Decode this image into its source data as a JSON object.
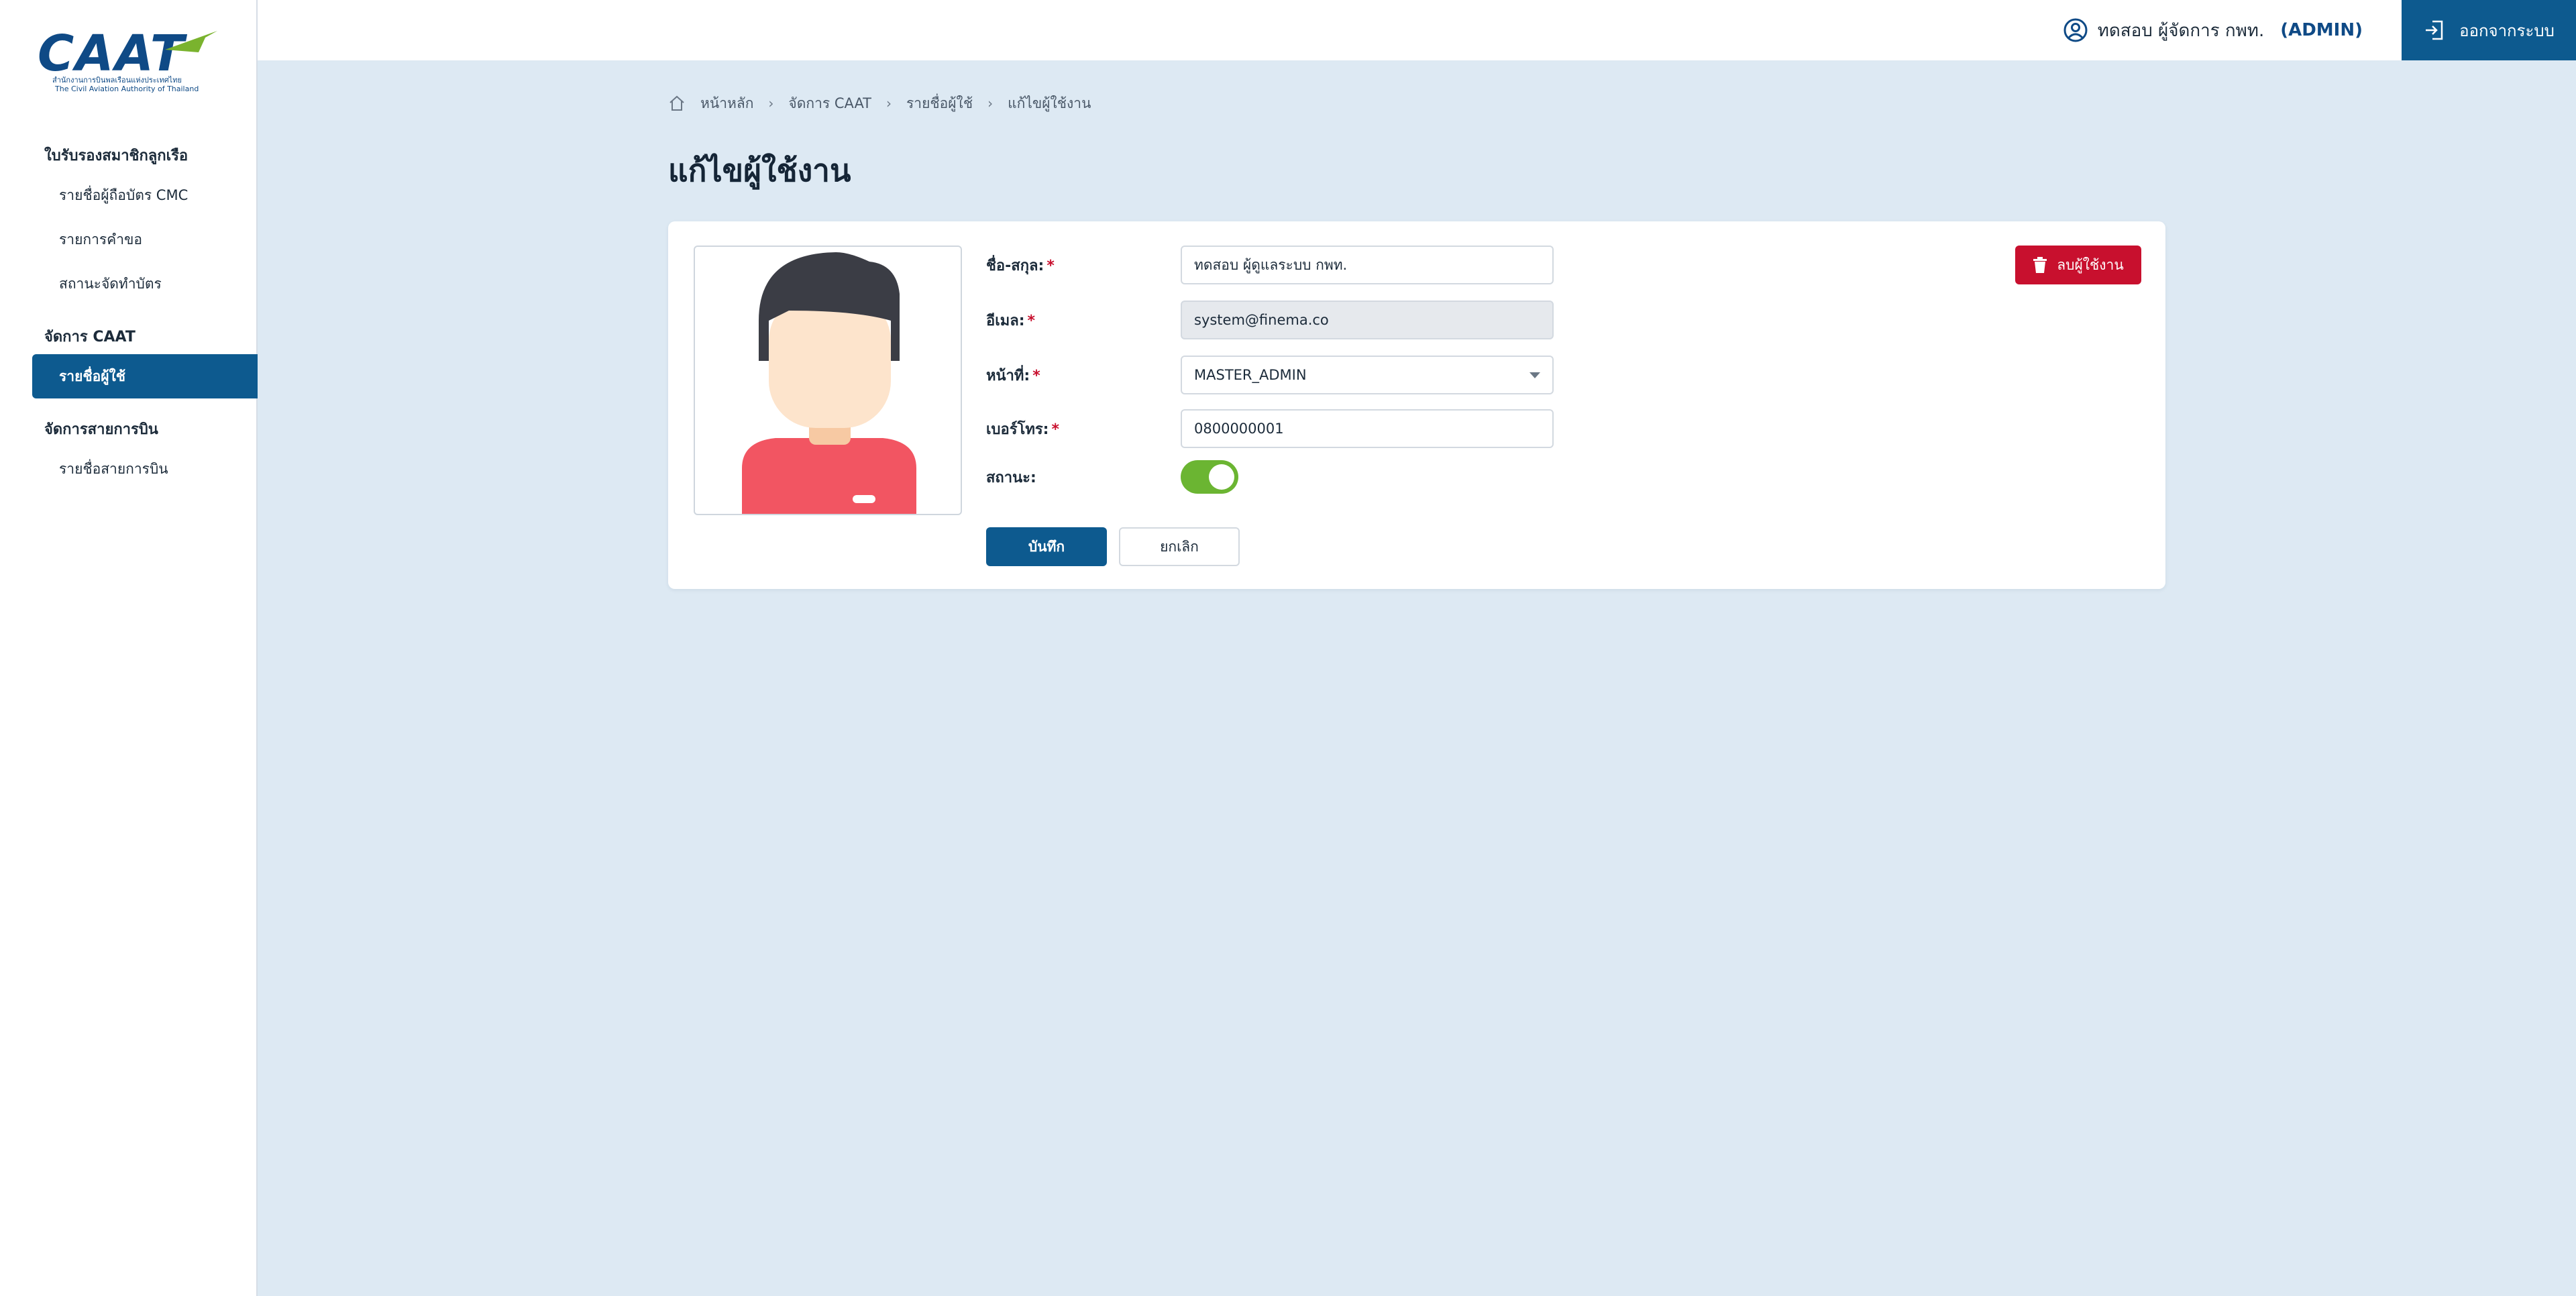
{
  "brand": {
    "logo_text": "CAAT",
    "logo_sub_th": "สำนักงานการบินพลเรือนแห่งประเทศไทย",
    "logo_sub_en": "The Civil Aviation Authority of Thailand"
  },
  "sidebar": {
    "groups": [
      {
        "label": "ใบรับรองสมาชิกลูกเรือ",
        "items": [
          {
            "label": "รายชื่อผู้ถือบัตร CMC"
          },
          {
            "label": "รายการคำขอ"
          },
          {
            "label": "สถานะจัดทำบัตร"
          }
        ]
      },
      {
        "label": "จัดการ CAAT",
        "items": [
          {
            "label": "รายชื่อผู้ใช้",
            "active": true
          }
        ]
      },
      {
        "label": "จัดการสายการบิน",
        "items": [
          {
            "label": "รายชื่อสายการบิน"
          }
        ]
      }
    ]
  },
  "header": {
    "user_name": "ทดสอบ ผู้จัดการ กพท.",
    "user_role": "(ADMIN)",
    "logout_label": "ออกจากระบบ"
  },
  "breadcrumb": [
    "หน้าหลัก",
    "จัดการ CAAT",
    "รายชื่อผู้ใช้",
    "แก้ไขผู้ใช้งาน"
  ],
  "page_title": "แก้ไขผู้ใช้งาน",
  "form": {
    "name_label": "ชื่อ-สกุล:",
    "name_value": "ทดสอบ ผู้ดูแลระบบ กพท.",
    "email_label": "อีเมล:",
    "email_value": "system@finema.co",
    "role_label": "หน้าที่:",
    "role_value": "MASTER_ADMIN",
    "phone_label": "เบอร์โทร:",
    "phone_value": "0800000001",
    "status_label": "สถานะ:",
    "status_on": true,
    "required_mark": "*",
    "save_label": "บันทึก",
    "cancel_label": "ยกเลิก",
    "delete_label": "ลบผู้ใช้งาน"
  },
  "colors": {
    "primary": "#0d5a8f",
    "danger": "#c8102e",
    "toggle_on": "#6bb532",
    "background": "#dde9f3"
  }
}
